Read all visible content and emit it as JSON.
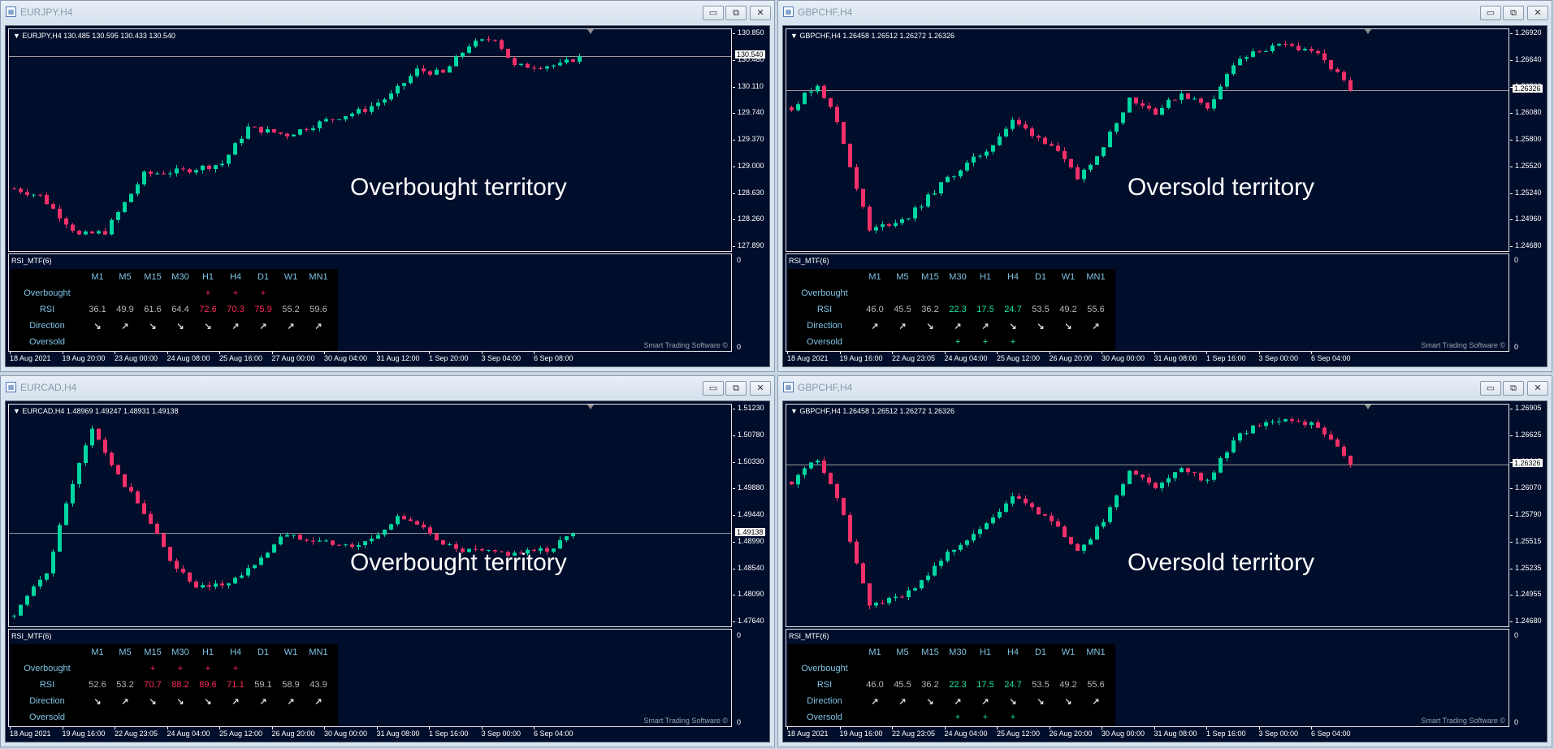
{
  "colors": {
    "bull": "#00d6a0",
    "bear": "#f2306a",
    "background": "#000d2b",
    "price_line": "#9a9a9a"
  },
  "timeframes": [
    "M1",
    "M5",
    "M15",
    "M30",
    "H1",
    "H4",
    "D1",
    "W1",
    "MN1"
  ],
  "row_labels": {
    "overbought": "Overbought",
    "rsi": "RSI",
    "direction": "Direction",
    "oversold": "Oversold"
  },
  "indicator_name": "RSI_MTF(6)",
  "brand": "Smart Trading Software ©",
  "indicator_axis": [
    "0",
    "0"
  ],
  "window_buttons": {
    "minimize": "▭",
    "restore": "⧉",
    "close": "✕"
  },
  "windows": [
    {
      "title": "EURJPY,H4",
      "header": "EURJPY,H4  130.485 130.595 130.433 130.540",
      "annotation": "Overbought territory",
      "current_price": "130.540",
      "price_labels": [
        "130.850",
        "130.480",
        "130.110",
        "129.740",
        "129.370",
        "129.000",
        "128.630",
        "128.260",
        "127.890"
      ],
      "price_range": [
        127.89,
        130.85
      ],
      "time_labels": [
        "18 Aug 2021",
        "19 Aug 20:00",
        "23 Aug 00:00",
        "24 Aug 08:00",
        "25 Aug 16:00",
        "27 Aug 00:00",
        "30 Aug 04:00",
        "31 Aug 12:00",
        "1 Sep 20:00",
        "3 Sep 04:00",
        "6 Sep 08:00"
      ],
      "price_path": [
        [
          0,
          128.7
        ],
        [
          4,
          128.6
        ],
        [
          10,
          128.05
        ],
        [
          14,
          128.1
        ],
        [
          20,
          128.9
        ],
        [
          26,
          128.95
        ],
        [
          32,
          129.05
        ],
        [
          36,
          129.55
        ],
        [
          42,
          129.45
        ],
        [
          48,
          129.65
        ],
        [
          54,
          129.8
        ],
        [
          58,
          130.0
        ],
        [
          62,
          130.35
        ],
        [
          66,
          130.3
        ],
        [
          70,
          130.7
        ],
        [
          74,
          130.8
        ],
        [
          77,
          130.4
        ],
        [
          84,
          130.42
        ],
        [
          87,
          130.54
        ]
      ],
      "rsi": [
        "36.1",
        "49.9",
        "61.6",
        "64.4",
        "72.6",
        "70.3",
        "75.9",
        "55.2",
        "59.6"
      ],
      "status": [
        "neutral",
        "neutral",
        "neutral",
        "neutral",
        "overbought",
        "overbought",
        "overbought",
        "neutral",
        "neutral"
      ],
      "overbought_marks": [
        "",
        "",
        "",
        "",
        "+",
        "+",
        "+",
        "",
        ""
      ],
      "oversold_marks": [
        "",
        "",
        "",
        "",
        "",
        "",
        "",
        "",
        ""
      ],
      "direction": [
        "↘",
        "↗",
        "↘",
        "↘",
        "↘",
        "↗",
        "↗",
        "↗",
        "↗"
      ]
    },
    {
      "title": "GBPCHF,H4",
      "header": "GBPCHF,H4  1.26458 1.26512 1.26272 1.26326",
      "annotation": "Oversold territory",
      "current_price": "1.26326",
      "price_labels": [
        "1.26920",
        "1.26640",
        "1.26360",
        "1.26080",
        "1.25800",
        "1.25520",
        "1.25240",
        "1.24960",
        "1.24680"
      ],
      "price_range": [
        1.2468,
        1.2692
      ],
      "time_labels": [
        "18 Aug 2021",
        "19 Aug 16:00",
        "22 Aug 23:05",
        "24 Aug 04:00",
        "25 Aug 12:00",
        "26 Aug 20:00",
        "30 Aug 00:00",
        "31 Aug 08:00",
        "1 Sep 16:00",
        "3 Sep 00:00",
        "6 Sep 04:00"
      ],
      "price_path": [
        [
          0,
          1.2615
        ],
        [
          4,
          1.264
        ],
        [
          7,
          1.26
        ],
        [
          12,
          1.2485
        ],
        [
          18,
          1.25
        ],
        [
          24,
          1.254
        ],
        [
          30,
          1.257
        ],
        [
          34,
          1.26
        ],
        [
          40,
          1.2575
        ],
        [
          44,
          1.254
        ],
        [
          48,
          1.2575
        ],
        [
          52,
          1.2625
        ],
        [
          56,
          1.261
        ],
        [
          60,
          1.263
        ],
        [
          64,
          1.2615
        ],
        [
          68,
          1.266
        ],
        [
          72,
          1.2675
        ],
        [
          76,
          1.268
        ],
        [
          80,
          1.2675
        ],
        [
          84,
          1.265
        ],
        [
          86,
          1.26326
        ]
      ],
      "rsi": [
        "46.0",
        "45.5",
        "36.2",
        "22.3",
        "17.5",
        "24.7",
        "53.5",
        "49.2",
        "55.6"
      ],
      "status": [
        "neutral",
        "neutral",
        "neutral",
        "oversold",
        "oversold",
        "oversold",
        "neutral",
        "neutral",
        "neutral"
      ],
      "overbought_marks": [
        "",
        "",
        "",
        "",
        "",
        "",
        "",
        "",
        ""
      ],
      "oversold_marks": [
        "",
        "",
        "",
        "+",
        "+",
        "+",
        "",
        "",
        ""
      ],
      "direction": [
        "↗",
        "↗",
        "↘",
        "↗",
        "↗",
        "↘",
        "↘",
        "↘",
        "↗"
      ]
    },
    {
      "title": "EURCAD,H4",
      "header": "EURCAD,H4  1.48969 1.49247 1.48931 1.49138",
      "annotation": "Overbought territory",
      "current_price": "1.49138",
      "price_labels": [
        "1.51230",
        "1.50780",
        "1.50330",
        "1.49880",
        "1.49440",
        "1.48990",
        "1.48540",
        "1.48090",
        "1.47640"
      ],
      "price_range": [
        1.4764,
        1.5123
      ],
      "time_labels": [
        "18 Aug 2021",
        "19 Aug 16:00",
        "22 Aug 23:05",
        "24 Aug 04:00",
        "25 Aug 12:00",
        "26 Aug 20:00",
        "30 Aug 00:00",
        "31 Aug 08:00",
        "1 Sep 16:00",
        "3 Sep 00:00",
        "6 Sep 04:00"
      ],
      "price_path": [
        [
          0,
          1.4775
        ],
        [
          5,
          1.485
        ],
        [
          9,
          1.5
        ],
        [
          12,
          1.509
        ],
        [
          16,
          1.501
        ],
        [
          20,
          1.495
        ],
        [
          24,
          1.487
        ],
        [
          28,
          1.482
        ],
        [
          33,
          1.483
        ],
        [
          38,
          1.487
        ],
        [
          41,
          1.491
        ],
        [
          46,
          1.4905
        ],
        [
          52,
          1.489
        ],
        [
          56,
          1.491
        ],
        [
          59,
          1.4945
        ],
        [
          63,
          1.492
        ],
        [
          68,
          1.4885
        ],
        [
          76,
          1.488
        ],
        [
          82,
          1.4885
        ],
        [
          86,
          1.49138
        ]
      ],
      "rsi": [
        "52.6",
        "53.2",
        "70.7",
        "88.2",
        "89.6",
        "71.1",
        "59.1",
        "58.9",
        "43.9"
      ],
      "status": [
        "neutral",
        "neutral",
        "overbought",
        "overbought",
        "overbought",
        "overbought",
        "neutral",
        "neutral",
        "neutral"
      ],
      "overbought_marks": [
        "",
        "",
        "+",
        "+",
        "+",
        "+",
        "",
        "",
        ""
      ],
      "oversold_marks": [
        "",
        "",
        "",
        "",
        "",
        "",
        "",
        "",
        ""
      ],
      "direction": [
        "↘",
        "↗",
        "↘",
        "↘",
        "↘",
        "↗",
        "↗",
        "↗",
        "↗"
      ]
    },
    {
      "title": "GBPCHF,H4",
      "header": "GBPCHF,H4  1.26458 1.26512 1.26272 1.26326",
      "annotation": "Oversold territory",
      "current_price": "1.26326",
      "price_labels": [
        "1.26905",
        "1.26625",
        "1.26345",
        "1.26070",
        "1.25790",
        "1.25515",
        "1.25235",
        "1.24955",
        "1.24680"
      ],
      "price_range": [
        1.2468,
        1.26905
      ],
      "time_labels": [
        "18 Aug 2021",
        "19 Aug 16:00",
        "22 Aug 23:05",
        "24 Aug 04:00",
        "25 Aug 12:00",
        "26 Aug 20:00",
        "30 Aug 00:00",
        "31 Aug 08:00",
        "1 Sep 16:00",
        "3 Sep 00:00",
        "6 Sep 04:00"
      ],
      "price_path": [
        [
          0,
          1.2615
        ],
        [
          4,
          1.264
        ],
        [
          7,
          1.26
        ],
        [
          12,
          1.2485
        ],
        [
          18,
          1.25
        ],
        [
          24,
          1.254
        ],
        [
          30,
          1.257
        ],
        [
          34,
          1.26
        ],
        [
          40,
          1.2575
        ],
        [
          44,
          1.254
        ],
        [
          48,
          1.2575
        ],
        [
          52,
          1.2625
        ],
        [
          56,
          1.261
        ],
        [
          60,
          1.263
        ],
        [
          64,
          1.2615
        ],
        [
          68,
          1.266
        ],
        [
          72,
          1.2675
        ],
        [
          76,
          1.268
        ],
        [
          80,
          1.2675
        ],
        [
          84,
          1.265
        ],
        [
          86,
          1.26326
        ]
      ],
      "rsi": [
        "46.0",
        "45.5",
        "36.2",
        "22.3",
        "17.5",
        "24.7",
        "53.5",
        "49.2",
        "55.6"
      ],
      "status": [
        "neutral",
        "neutral",
        "neutral",
        "oversold",
        "oversold",
        "oversold",
        "neutral",
        "neutral",
        "neutral"
      ],
      "overbought_marks": [
        "",
        "",
        "",
        "",
        "",
        "",
        "",
        "",
        ""
      ],
      "oversold_marks": [
        "",
        "",
        "",
        "+",
        "+",
        "+",
        "",
        "",
        ""
      ],
      "direction": [
        "↗",
        "↗",
        "↘",
        "↗",
        "↗",
        "↘",
        "↘",
        "↘",
        "↗"
      ]
    }
  ]
}
